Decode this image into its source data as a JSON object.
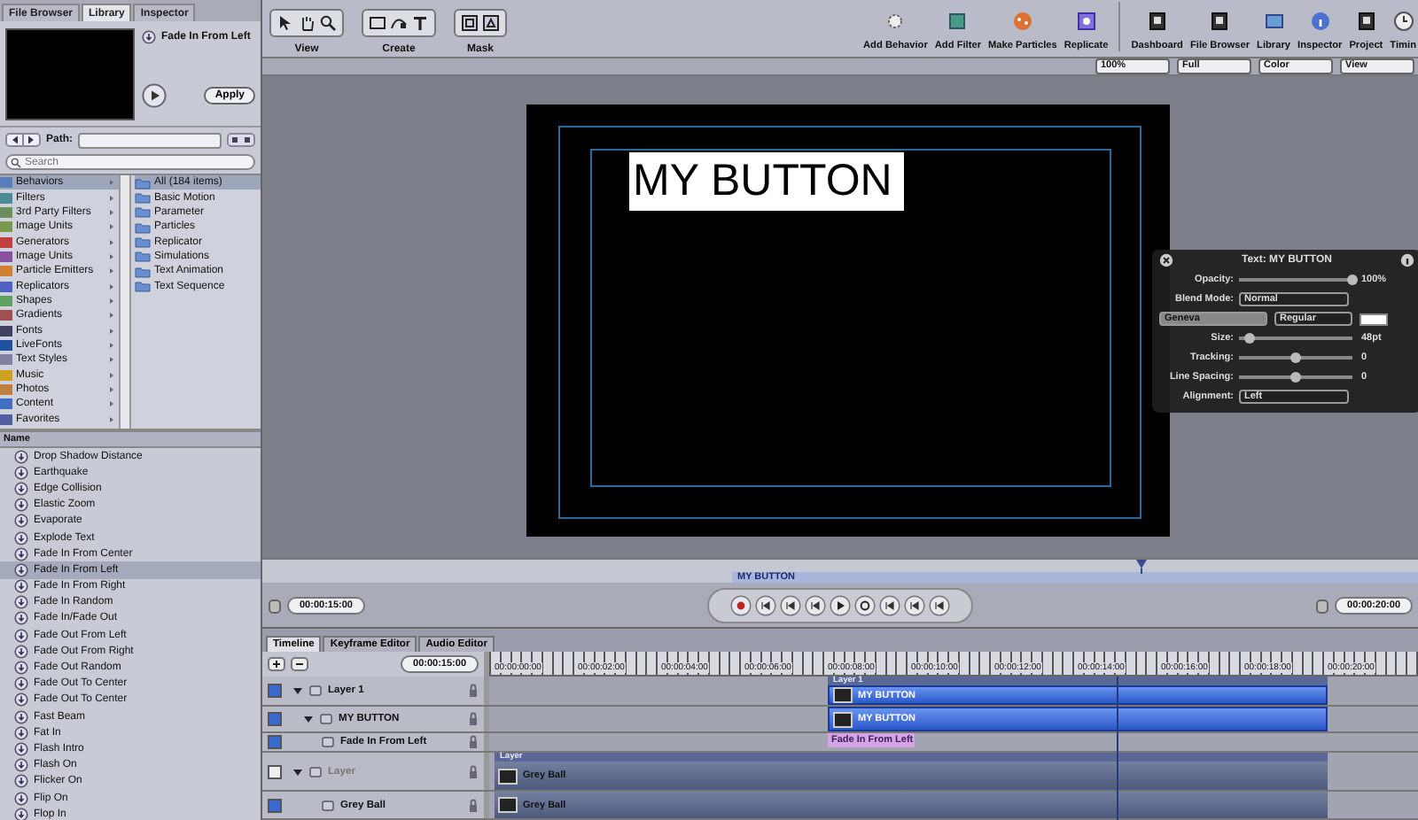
{
  "left_tabs": [
    {
      "label": "File Browser",
      "selected": false
    },
    {
      "label": "Library",
      "selected": true
    },
    {
      "label": "Inspector",
      "selected": false
    }
  ],
  "preview": {
    "title": "Fade In From Left",
    "apply_button": "Apply"
  },
  "path_bar": {
    "label": "Path:"
  },
  "search": {
    "placeholder": "Search"
  },
  "categories": [
    {
      "label": "Behaviors",
      "selected": true
    },
    {
      "label": "Filters",
      "selected": false
    },
    {
      "label": "3rd Party Filters",
      "selected": false
    },
    {
      "label": "Image Units",
      "selected": false
    },
    {
      "label": "Generators",
      "selected": false
    },
    {
      "label": "Image Units",
      "selected": false
    },
    {
      "label": "Particle Emitters",
      "selected": false
    },
    {
      "label": "Replicators",
      "selected": false
    },
    {
      "label": "Shapes",
      "selected": false
    },
    {
      "label": "Gradients",
      "selected": false
    },
    {
      "label": "Fonts",
      "selected": false
    },
    {
      "label": "LiveFonts",
      "selected": false
    },
    {
      "label": "Text Styles",
      "selected": false
    },
    {
      "label": "Music",
      "selected": false
    },
    {
      "label": "Photos",
      "selected": false
    },
    {
      "label": "Content",
      "selected": false
    },
    {
      "label": "Favorites",
      "selected": false
    }
  ],
  "subcategories": [
    {
      "label": "All (184 items)",
      "selected": true
    },
    {
      "label": "Basic Motion",
      "selected": false
    },
    {
      "label": "Parameter",
      "selected": false
    },
    {
      "label": "Particles",
      "selected": false
    },
    {
      "label": "Replicator",
      "selected": false
    },
    {
      "label": "Simulations",
      "selected": false
    },
    {
      "label": "Text Animation",
      "selected": false
    },
    {
      "label": "Text Sequence",
      "selected": false
    }
  ],
  "list_header": "Name",
  "behaviors": [
    {
      "label": "Drop Shadow Distance",
      "selected": false
    },
    {
      "label": "Earthquake",
      "selected": false
    },
    {
      "label": "Edge Collision",
      "selected": false
    },
    {
      "label": "Elastic Zoom",
      "selected": false
    },
    {
      "label": "Evaporate",
      "selected": false
    },
    {
      "label": "Explode Text",
      "selected": false
    },
    {
      "label": "Fade In From Center",
      "selected": false
    },
    {
      "label": "Fade In From Left",
      "selected": true
    },
    {
      "label": "Fade In From Right",
      "selected": false
    },
    {
      "label": "Fade In Random",
      "selected": false
    },
    {
      "label": "Fade In/Fade Out",
      "selected": false
    },
    {
      "label": "Fade Out From Left",
      "selected": false
    },
    {
      "label": "Fade Out From Right",
      "selected": false
    },
    {
      "label": "Fade Out Random",
      "selected": false
    },
    {
      "label": "Fade Out To Center",
      "selected": false
    },
    {
      "label": "Fade Out To Center",
      "selected": false
    },
    {
      "label": "Fast Beam",
      "selected": false
    },
    {
      "label": "Fat In",
      "selected": false
    },
    {
      "label": "Flash Intro",
      "selected": false
    },
    {
      "label": "Flash On",
      "selected": false
    },
    {
      "label": "Flicker On",
      "selected": false
    },
    {
      "label": "Flip On",
      "selected": false
    },
    {
      "label": "Flop In",
      "selected": false
    }
  ],
  "toolbar_groups": [
    {
      "label": "View"
    },
    {
      "label": "Create"
    },
    {
      "label": "Mask"
    }
  ],
  "toolbar_actions": [
    {
      "label": "Add Behavior"
    },
    {
      "label": "Add Filter"
    },
    {
      "label": "Make Particles"
    },
    {
      "label": "Replicate"
    }
  ],
  "toolbar_panels": [
    {
      "label": "Dashboard"
    },
    {
      "label": "File Browser"
    },
    {
      "label": "Library"
    },
    {
      "label": "Inspector"
    },
    {
      "label": "Project"
    },
    {
      "label": "Timin"
    }
  ],
  "view_menus": [
    "100%",
    "Full",
    "Color",
    "View"
  ],
  "canvas": {
    "text": "MY BUTTON"
  },
  "hud": {
    "title": "Text: MY BUTTON",
    "rows": [
      {
        "kind": "slider",
        "label": "Opacity:",
        "level": 1,
        "reading": "100%"
      },
      {
        "kind": "menu",
        "label": "Blend Mode:",
        "value": "Normal"
      },
      {
        "kind": "font",
        "font": "Geneva",
        "style": "Regular"
      },
      {
        "kind": "slider",
        "label": "Size:",
        "level": 0.1,
        "reading": "48pt"
      },
      {
        "kind": "slider",
        "label": "Tracking:",
        "level": 0.5,
        "reading": "0"
      },
      {
        "kind": "slider",
        "label": "Line Spacing:",
        "level": 0.5,
        "reading": "0"
      },
      {
        "kind": "menu",
        "label": "Alignment:",
        "value": "Left"
      }
    ]
  },
  "mini_timeline": {
    "label": "MY BUTTON",
    "playhead": {
      "level": 0.76
    }
  },
  "transport": {
    "current_time": "00:00:15:00",
    "end_time": "00:00:20:00"
  },
  "timeline_tabs": [
    {
      "label": "Timeline",
      "selected": true
    },
    {
      "label": "Keyframe Editor",
      "selected": false
    },
    {
      "label": "Audio Editor",
      "selected": false
    }
  ],
  "timeline": {
    "duration": "00:00:15:00",
    "ticks": [
      "00:00:00:00",
      "00:00:02:00",
      "00:00:04:00",
      "00:00:06:00",
      "00:00:08:00",
      "00:00:10:00",
      "00:00:12:00",
      "00:00:14:00",
      "00:00:16:00",
      "00:00:18:00",
      "00:00:20:00"
    ],
    "playhead": {
      "level": 0.74
    },
    "layers": [
      {
        "kind": "group",
        "name": "Layer 1",
        "checked": true,
        "expanded": true,
        "header": "Layer 1",
        "clip": "MY BUTTON"
      },
      {
        "kind": "text",
        "name": "MY BUTTON",
        "checked": true,
        "expanded": true,
        "clip": "MY BUTTON"
      },
      {
        "kind": "behavior",
        "name": "Fade In From Left",
        "checked": true,
        "clip": "Fade In From Left"
      },
      {
        "kind": "backdrop",
        "name": "Layer",
        "checked": false,
        "expanded": true,
        "header": "Layer",
        "clip": "Grey Ball"
      },
      {
        "kind": "image",
        "name": "Grey Ball",
        "checked": true,
        "clip": "Grey Ball"
      }
    ]
  }
}
